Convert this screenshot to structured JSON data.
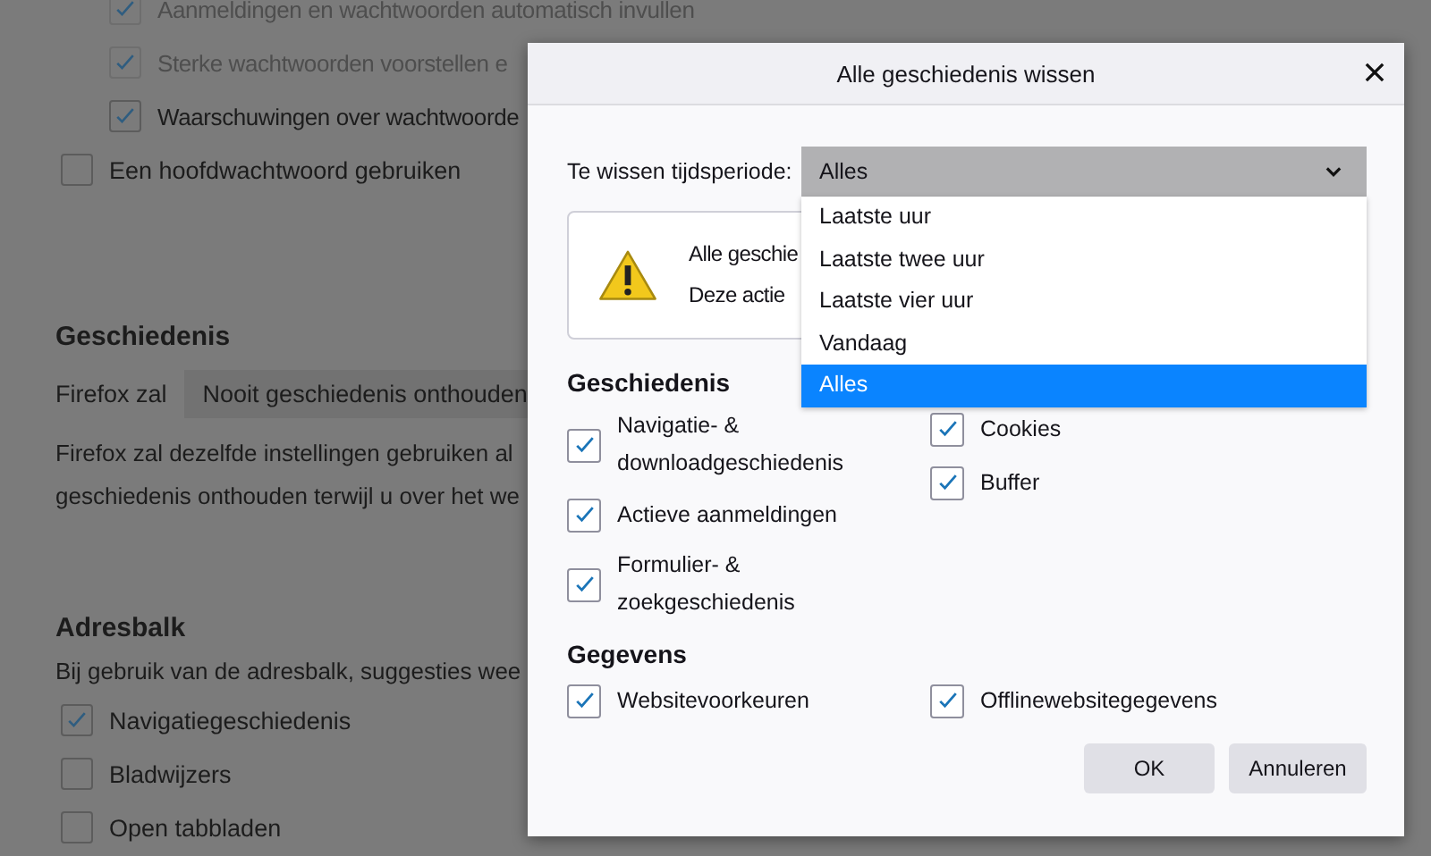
{
  "background_page": {
    "password_sub_options": [
      {
        "label": "Aanmeldingen en wachtwoorden automatisch invullen",
        "checked": true,
        "disabled": true
      },
      {
        "label": "Sterke wachtwoorden voorstellen e",
        "checked": true,
        "disabled": true
      },
      {
        "label": "Waarschuwingen over wachtwoorde",
        "checked": true,
        "disabled": false
      }
    ],
    "password_options": [
      {
        "label": "Een hoofdwachtwoord gebruiken",
        "checked": false
      }
    ],
    "history": {
      "heading": "Geschiedenis",
      "label": "Firefox zal",
      "select_value": "Nooit geschiedenis onthouden",
      "description_lines": [
        "Firefox zal dezelfde instellingen gebruiken al",
        "geschiedenis onthouden terwijl u over het we"
      ]
    },
    "address_bar": {
      "heading": "Adresbalk",
      "description": "Bij gebruik van de adresbalk, suggesties wee",
      "options": [
        {
          "label": "Navigatiegeschiedenis",
          "checked": true
        },
        {
          "label": "Bladwijzers",
          "checked": false
        },
        {
          "label": "Open tabbladen",
          "checked": false
        }
      ]
    }
  },
  "dialog": {
    "title": "Alle geschiedenis wissen",
    "period_label": "Te wissen tijdsperiode:",
    "period_select": {
      "value": "Alles"
    },
    "period_options": [
      {
        "label": "Laatste uur",
        "selected": false
      },
      {
        "label": "Laatste twee uur",
        "selected": false
      },
      {
        "label": "Laatste vier uur",
        "selected": false
      },
      {
        "label": "Vandaag",
        "selected": false
      },
      {
        "label": "Alles",
        "selected": true
      }
    ],
    "warning_lines": [
      "Alle geschie",
      "Deze actie"
    ],
    "sections": [
      {
        "heading": "Geschiedenis",
        "columns": [
          [
            {
              "label": "Navigatie- & downloadgeschiedenis",
              "checked": true
            },
            {
              "label": "Actieve aanmeldingen",
              "checked": true
            },
            {
              "label": "Formulier- & zoekgeschiedenis",
              "checked": true
            }
          ],
          [
            {
              "label": "Cookies",
              "checked": true
            },
            {
              "label": "Buffer",
              "checked": true
            }
          ]
        ]
      },
      {
        "heading": "Gegevens",
        "columns": [
          [
            {
              "label": "Websitevoorkeuren",
              "checked": true
            }
          ],
          [
            {
              "label": "Offlinewebsitegegevens",
              "checked": true
            }
          ]
        ]
      }
    ],
    "buttons": [
      "OK",
      "Annuleren"
    ]
  }
}
